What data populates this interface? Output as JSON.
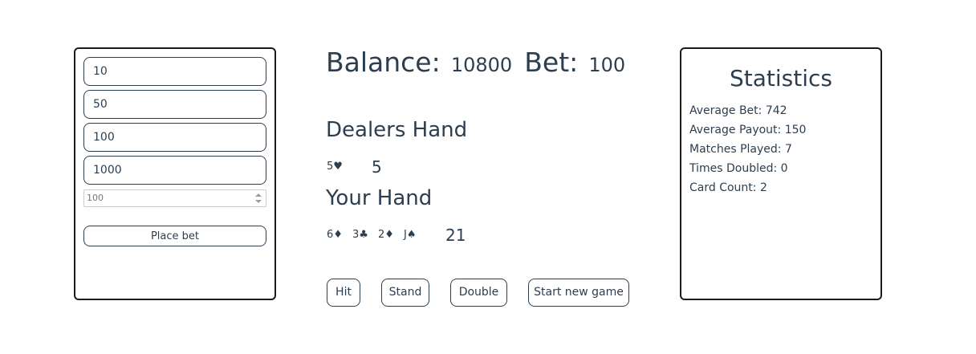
{
  "bet_panel": {
    "chips": [
      "10",
      "50",
      "100",
      "1000"
    ],
    "bet_input_value": "100",
    "place_bet_label": "Place bet"
  },
  "game": {
    "balance_label": "Balance:",
    "balance_value": "10800",
    "bet_label": "Bet:",
    "bet_value": "100",
    "dealer_title": "Dealers Hand",
    "dealer_cards": [
      "5♥"
    ],
    "dealer_total": "5",
    "player_title": "Your Hand",
    "player_cards": [
      "6♦",
      "3♣",
      "2♦",
      "J♠"
    ],
    "player_total": "21",
    "actions": {
      "hit": "Hit",
      "stand": "Stand",
      "double": "Double",
      "new_game": "Start new game"
    }
  },
  "stats": {
    "title": "Statistics",
    "lines": [
      "Average Bet: 742",
      "Average Payout: 150",
      "Matches Played: 7",
      "Times Doubled: 0",
      "Card Count: 2"
    ]
  }
}
